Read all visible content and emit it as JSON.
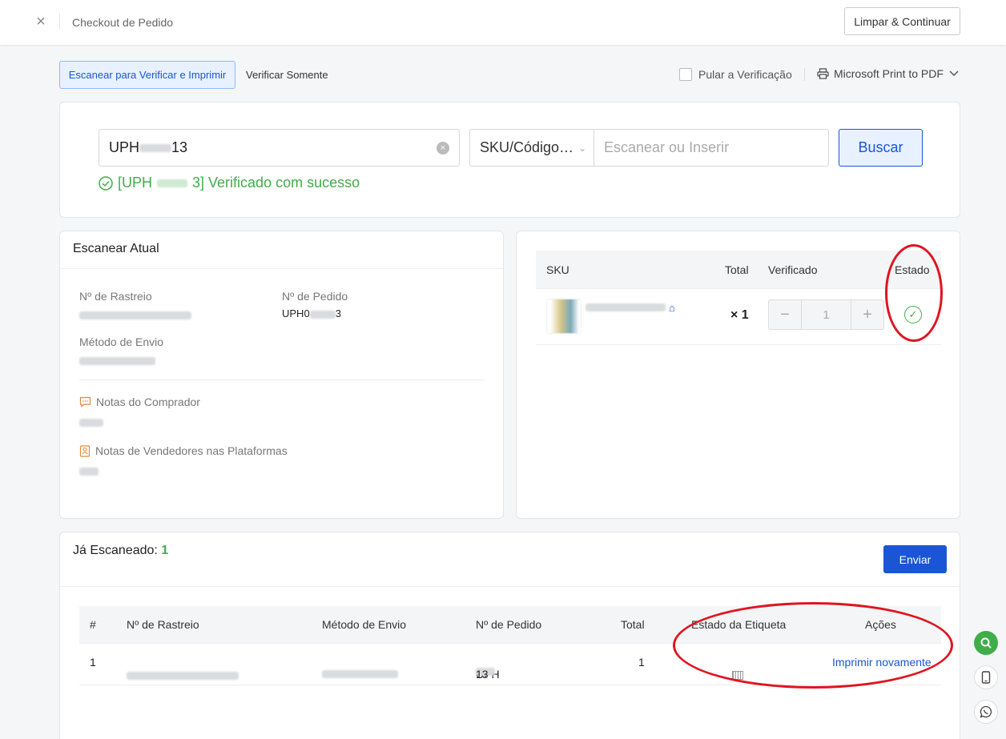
{
  "header": {
    "title": "Checkout de Pedido",
    "clear_continue_label": "Limpar & Continuar"
  },
  "mode": {
    "scan_verify_print_label": "Escanear para Verificar e Imprimir",
    "verify_only_label": "Verificar Somente",
    "skip_verification_label": "Pular a Verificação",
    "printer_label": "Microsoft Print to PDF"
  },
  "search": {
    "order_prefix": "UPH",
    "order_suffix": "13",
    "sku_select_label": "SKU/Código…",
    "sku_placeholder": "Escanear ou Inserir",
    "search_button_label": "Buscar",
    "success_prefix": "[UPH",
    "success_suffix": "3] Verificado com sucesso"
  },
  "current_scan": {
    "title": "Escanear Atual",
    "tracking_label": "Nº de Rastreio",
    "order_label": "Nº de Pedido",
    "order_value_prefix": "UPH0",
    "order_value_suffix": "3",
    "shipping_label": "Método de Envio",
    "buyer_notes_label": "Notas do Comprador",
    "seller_notes_label": "Notas de Vendedores nas Plataformas"
  },
  "sku_table": {
    "headers": {
      "sku": "SKU",
      "total": "Total",
      "verified": "Verificado",
      "status": "Estado"
    },
    "row": {
      "qty": "× 1",
      "verified_value": "1",
      "minus": "−",
      "plus": "+"
    }
  },
  "scanned": {
    "title": "Já Escaneado:",
    "count": "1",
    "send_label": "Enviar",
    "headers": {
      "index": "#",
      "tracking": "Nº de Rastreio",
      "shipping": "Método de Envio",
      "order": "Nº de Pedido",
      "total": "Total",
      "label_status": "Estado da Etiqueta",
      "actions": "Ações"
    },
    "row": {
      "index": "1",
      "order_prefix": "UPH",
      "order_suffix": "13",
      "total": "1",
      "action_label": "Imprimir novamente"
    }
  },
  "colors": {
    "accent": "#1a55d6",
    "success": "#3fae48",
    "annotation": "#e0141f"
  }
}
